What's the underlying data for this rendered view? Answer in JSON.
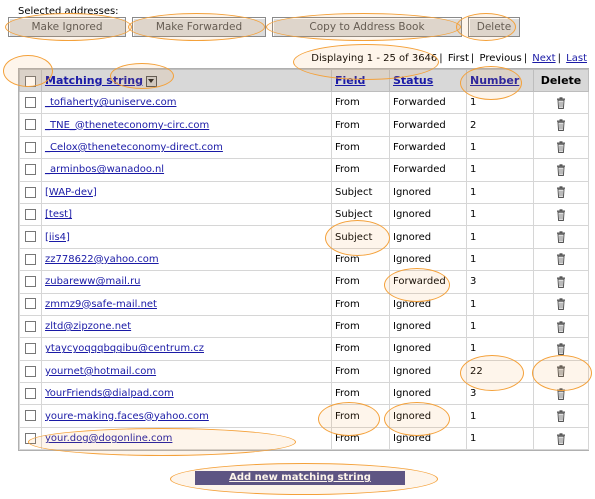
{
  "selected_label": "Selected addresses:",
  "buttons": {
    "ignore": "Make Ignored",
    "forward": "Make Forwarded",
    "copy": "Copy to Address Book",
    "delete": "Delete"
  },
  "pager": {
    "displaying": "Displaying 1 - 25 of 3646",
    "first": "First",
    "previous": "Previous",
    "next": "Next",
    "last": "Last"
  },
  "columns": {
    "matching": "Matching string",
    "field": "Field",
    "status": "Status",
    "number": "Number",
    "delete": "Delete"
  },
  "rows": [
    {
      "string": "_tofiaherty@uniserve.com",
      "field": "From",
      "status": "Forwarded",
      "number": "1"
    },
    {
      "string": "_TNE_@theneteconomy-circ.com",
      "field": "From",
      "status": "Forwarded",
      "number": "2"
    },
    {
      "string": "_Celox@theneteconomy-direct.com",
      "field": "From",
      "status": "Forwarded",
      "number": "1"
    },
    {
      "string": "_arminbos@wanadoo.nl",
      "field": "From",
      "status": "Forwarded",
      "number": "1"
    },
    {
      "string": "[WAP-dev]",
      "field": "Subject",
      "status": "Ignored",
      "number": "1"
    },
    {
      "string": "[test]",
      "field": "Subject",
      "status": "Ignored",
      "number": "1"
    },
    {
      "string": "[iis4]",
      "field": "Subject",
      "status": "Ignored",
      "number": "1"
    },
    {
      "string": "zz778622@yahoo.com",
      "field": "From",
      "status": "Ignored",
      "number": "1"
    },
    {
      "string": "zubareww@mail.ru",
      "field": "From",
      "status": "Forwarded",
      "number": "3"
    },
    {
      "string": "zmmz9@safe-mail.net",
      "field": "From",
      "status": "Ignored",
      "number": "1"
    },
    {
      "string": "zltd@zipzone.net",
      "field": "From",
      "status": "Ignored",
      "number": "1"
    },
    {
      "string": "ytaycyoqqqbqgibu@centrum.cz",
      "field": "From",
      "status": "Ignored",
      "number": "1"
    },
    {
      "string": "yournet@hotmail.com",
      "field": "From",
      "status": "Ignored",
      "number": "22"
    },
    {
      "string": "YourFriends@dialpad.com",
      "field": "From",
      "status": "Ignored",
      "number": "3"
    },
    {
      "string": "youre-making.faces@yahoo.com",
      "field": "From",
      "status": "Ignored",
      "number": "1"
    },
    {
      "string": "your.dog@dogonline.com",
      "field": "From",
      "status": "Ignored",
      "number": "1"
    }
  ],
  "add_label": "Add new matching string",
  "icons": {
    "trash": "trash-icon",
    "sort": "sort-dropdown-icon"
  },
  "colors": {
    "link": "#1a1aa6",
    "header_bg": "#d8d8d8",
    "highlight": "#f4a13a",
    "add_button": "#4d4d8c"
  }
}
